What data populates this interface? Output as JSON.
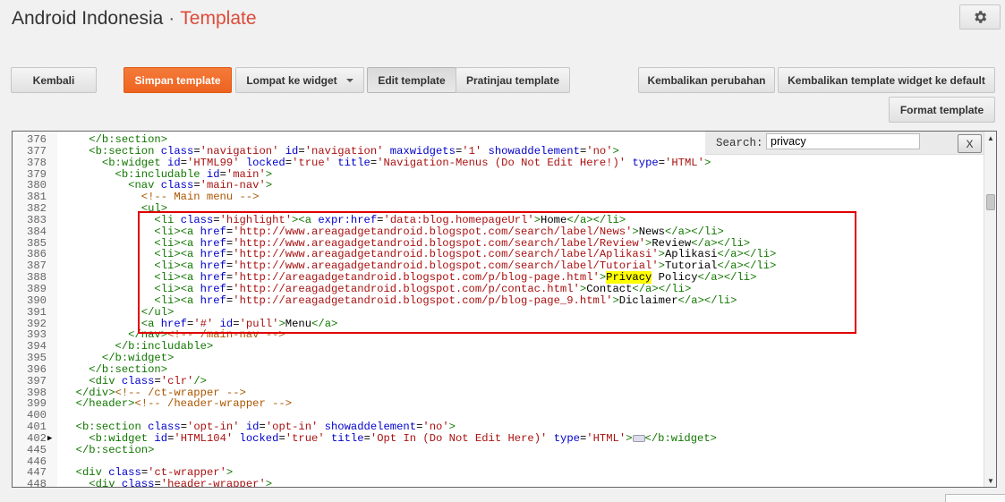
{
  "header": {
    "blog_name": "Android Indonesia",
    "separator": "·",
    "page_title": "Template"
  },
  "toolbar": {
    "back": "Kembali",
    "save": "Simpan template",
    "jump": "Lompat ke widget",
    "edit": "Edit template",
    "preview": "Pratinjau template",
    "revert": "Kembalikan perubahan",
    "revert_widgets": "Kembalikan template widget ke default",
    "format": "Format template"
  },
  "search": {
    "label": "Search:",
    "value": "privacy",
    "close": "X"
  },
  "code_lines": [
    {
      "n": "376",
      "code": "    </b:section>"
    },
    {
      "n": "377",
      "code": "    <b:section class='navigation' id='navigation' maxwidgets='1' showaddelement='no'>"
    },
    {
      "n": "378",
      "code": "      <b:widget id='HTML99' locked='true' title='Navigation-Menus (Do Not Edit Here!)' type='HTML'>"
    },
    {
      "n": "379",
      "code": "        <b:includable id='main'>"
    },
    {
      "n": "380",
      "code": "          <nav class='main-nav'>"
    },
    {
      "n": "381",
      "code": "            <!-- Main menu -->"
    },
    {
      "n": "382",
      "code": "            <ul>"
    },
    {
      "n": "383",
      "code": "              <li class='highlight'><a expr:href='data:blog.homepageUrl'>Home</a></li>"
    },
    {
      "n": "384",
      "code": "              <li><a href='http://www.areagadgetandroid.blogspot.com/search/label/News'>News</a></li>"
    },
    {
      "n": "385",
      "code": "              <li><a href='http://www.areagadgetandroid.blogspot.com/search/label/Review'>Review</a></li>"
    },
    {
      "n": "386",
      "code": "              <li><a href='http://www.areagadgetandroid.blogspot.com/search/label/Aplikasi'>Aplikasi</a></li>"
    },
    {
      "n": "387",
      "code": "              <li><a href='http://www.areagadgetandroid.blogspot.com/search/label/Tutorial'>Tutorial</a></li>"
    },
    {
      "n": "388",
      "code": "              <li><a href='http://areagadgetandroid.blogspot.com/p/blog-page.html'>Privacy Policy</a></li>"
    },
    {
      "n": "389",
      "code": "              <li><a href='http://areagadgetandroid.blogspot.com/p/contac.html'>Contact</a></li>"
    },
    {
      "n": "390",
      "code": "              <li><a href='http://areagadgetandroid.blogspot.com/p/blog-page_9.html'>Diclaimer</a></li>"
    },
    {
      "n": "391",
      "code": "            </ul>"
    },
    {
      "n": "392",
      "code": "            <a href='#' id='pull'>Menu</a>"
    },
    {
      "n": "393",
      "code": "          </nav><!-- /main-nav -->"
    },
    {
      "n": "394",
      "code": "        </b:includable>"
    },
    {
      "n": "395",
      "code": "      </b:widget>"
    },
    {
      "n": "396",
      "code": "    </b:section>"
    },
    {
      "n": "397",
      "code": "    <div class='clr'/>"
    },
    {
      "n": "398",
      "code": "  </div><!-- /ct-wrapper -->"
    },
    {
      "n": "399",
      "code": "  </header><!-- /header-wrapper -->"
    },
    {
      "n": "400",
      "code": ""
    },
    {
      "n": "401",
      "code": "  <b:section class='opt-in' id='opt-in' showaddelement='no'>"
    },
    {
      "n": "402",
      "code": "    <b:widget id='HTML104' locked='true' title='Opt In (Do Not Edit Here)' type='HTML'>…</b:widget>",
      "folded": true
    },
    {
      "n": "445",
      "code": "  </b:section>"
    },
    {
      "n": "446",
      "code": ""
    },
    {
      "n": "447",
      "code": "  <div class='ct-wrapper'>"
    },
    {
      "n": "448",
      "code": "    <div class='header-wrapper'>"
    }
  ],
  "colors": {
    "accent": "#dd4b39",
    "save_button": "#ee6320",
    "highlight_box": "#e00000",
    "search_match": "#ffff00"
  },
  "icons": {
    "settings": "gear-icon",
    "dropdown": "chevron-down-icon",
    "fold_marker": "fold-arrow-icon"
  }
}
